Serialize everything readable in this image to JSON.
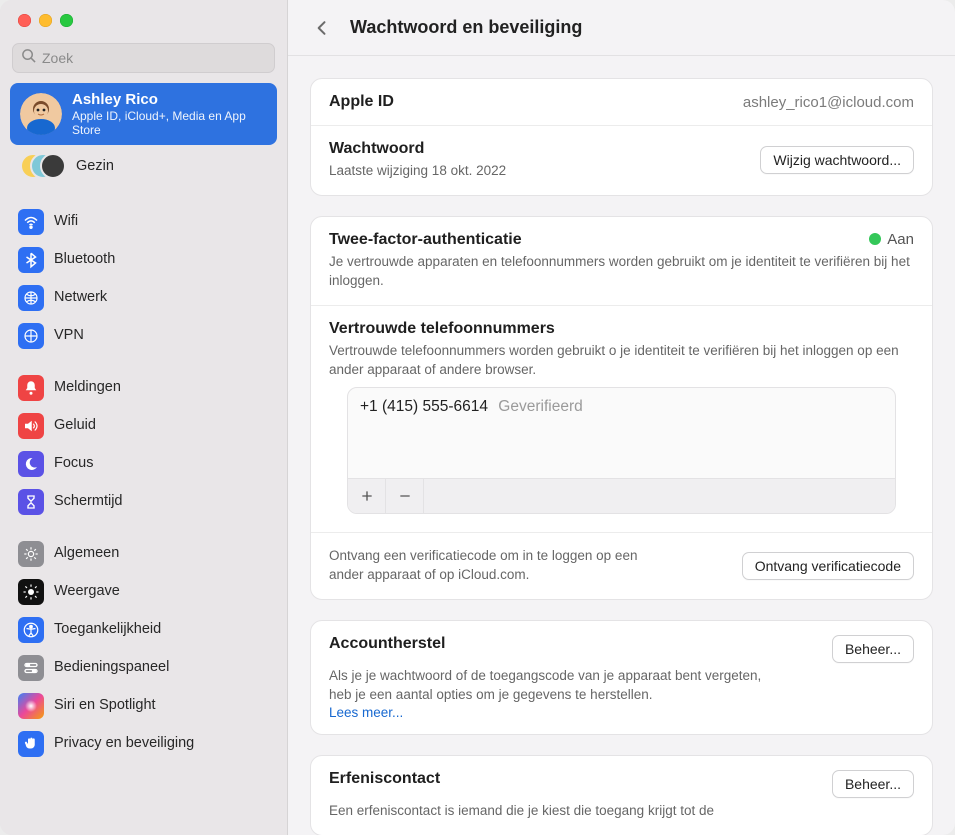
{
  "search": {
    "placeholder": "Zoek"
  },
  "account": {
    "name": "Ashley Rico",
    "subtitle": "Apple ID, iCloud+, Media en App Store"
  },
  "family": {
    "label": "Gezin"
  },
  "sidebar": {
    "items": [
      {
        "id": "wifi",
        "label": "Wifi"
      },
      {
        "id": "bluetooth",
        "label": "Bluetooth"
      },
      {
        "id": "netwerk",
        "label": "Netwerk"
      },
      {
        "id": "vpn",
        "label": "VPN"
      },
      {
        "id": "meldingen",
        "label": "Meldingen"
      },
      {
        "id": "geluid",
        "label": "Geluid"
      },
      {
        "id": "focus",
        "label": "Focus"
      },
      {
        "id": "schermtijd",
        "label": "Schermtijd"
      },
      {
        "id": "algemeen",
        "label": "Algemeen"
      },
      {
        "id": "weergave",
        "label": "Weergave"
      },
      {
        "id": "toegankelijkheid",
        "label": "Toegankelijkheid"
      },
      {
        "id": "bedieningspaneel",
        "label": "Bedieningspaneel"
      },
      {
        "id": "siri",
        "label": "Siri en Spotlight"
      },
      {
        "id": "privacy",
        "label": "Privacy en beveiliging"
      }
    ]
  },
  "header": {
    "title": "Wachtwoord en beveiliging"
  },
  "appleid": {
    "label": "Apple ID",
    "value": "ashley_rico1@icloud.com"
  },
  "password": {
    "label": "Wachtwoord",
    "sub": "Laatste wijziging 18 okt. 2022",
    "button": "Wijzig wachtwoord..."
  },
  "twofa": {
    "title": "Twee-factor-authenticatie",
    "status": "Aan",
    "desc": "Je vertrouwde apparaten en telefoonnummers worden gebruikt om je identiteit te verifiëren bij het inloggen."
  },
  "trusted": {
    "title": "Vertrouwde telefoonnummers",
    "desc": "Vertrouwde telefoonnummers worden gebruikt o je identiteit te verifiëren bij het inloggen op een ander apparaat of andere browser.",
    "numbers": [
      {
        "display": "+1 (415) 555-6614",
        "status": "Geverifieerd"
      }
    ]
  },
  "verify": {
    "desc": "Ontvang een verificatiecode om in te loggen op een ander apparaat of op iCloud.com.",
    "button": "Ontvang verificatiecode"
  },
  "recovery": {
    "title": "Accountherstel",
    "button": "Beheer...",
    "desc": "Als je je wachtwoord of de toegangscode van je apparaat bent vergeten, heb je een aantal opties om je gegevens te herstellen.",
    "link": "Lees meer..."
  },
  "legacy": {
    "title": "Erfeniscontact",
    "button": "Beheer...",
    "desc": "Een erfeniscontact is iemand die je kiest die toegang krijgt tot de"
  }
}
